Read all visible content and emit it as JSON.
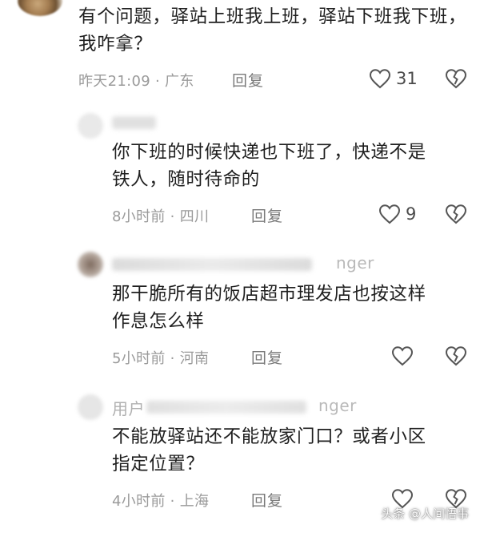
{
  "comments": [
    {
      "text_line1": "有个问题，驿站上班我上班，驿站下班我下班，",
      "text_line2": "我咋拿？",
      "time": "昨天21:09",
      "location": "广东",
      "reply_label": "回复",
      "likes": "31"
    },
    {
      "text_line1": "你下班的时候快递也下班了，快递不是",
      "text_line2": "铁人，随时待命的",
      "time": "8小时前",
      "location": "四川",
      "reply_label": "回复",
      "likes": "9"
    },
    {
      "name_tail": "nger",
      "text_line1": "那干脆所有的饭店超市理发店也按这样",
      "text_line2": "作息怎么样",
      "time": "5小时前",
      "location": "河南",
      "reply_label": "回复",
      "likes": ""
    },
    {
      "name_partial": "用户",
      "name_tail": "nger",
      "text_line1": "不能放驿站还不能放家门口？或者小区",
      "text_line2": "指定位置？",
      "time": "4小时前",
      "location": "上海",
      "reply_label": "回复",
      "likes": ""
    }
  ],
  "separator": "·",
  "watermark": "头条 @人间悟事",
  "icons": {
    "like": "heart-outline-icon",
    "dislike": "broken-heart-icon"
  }
}
